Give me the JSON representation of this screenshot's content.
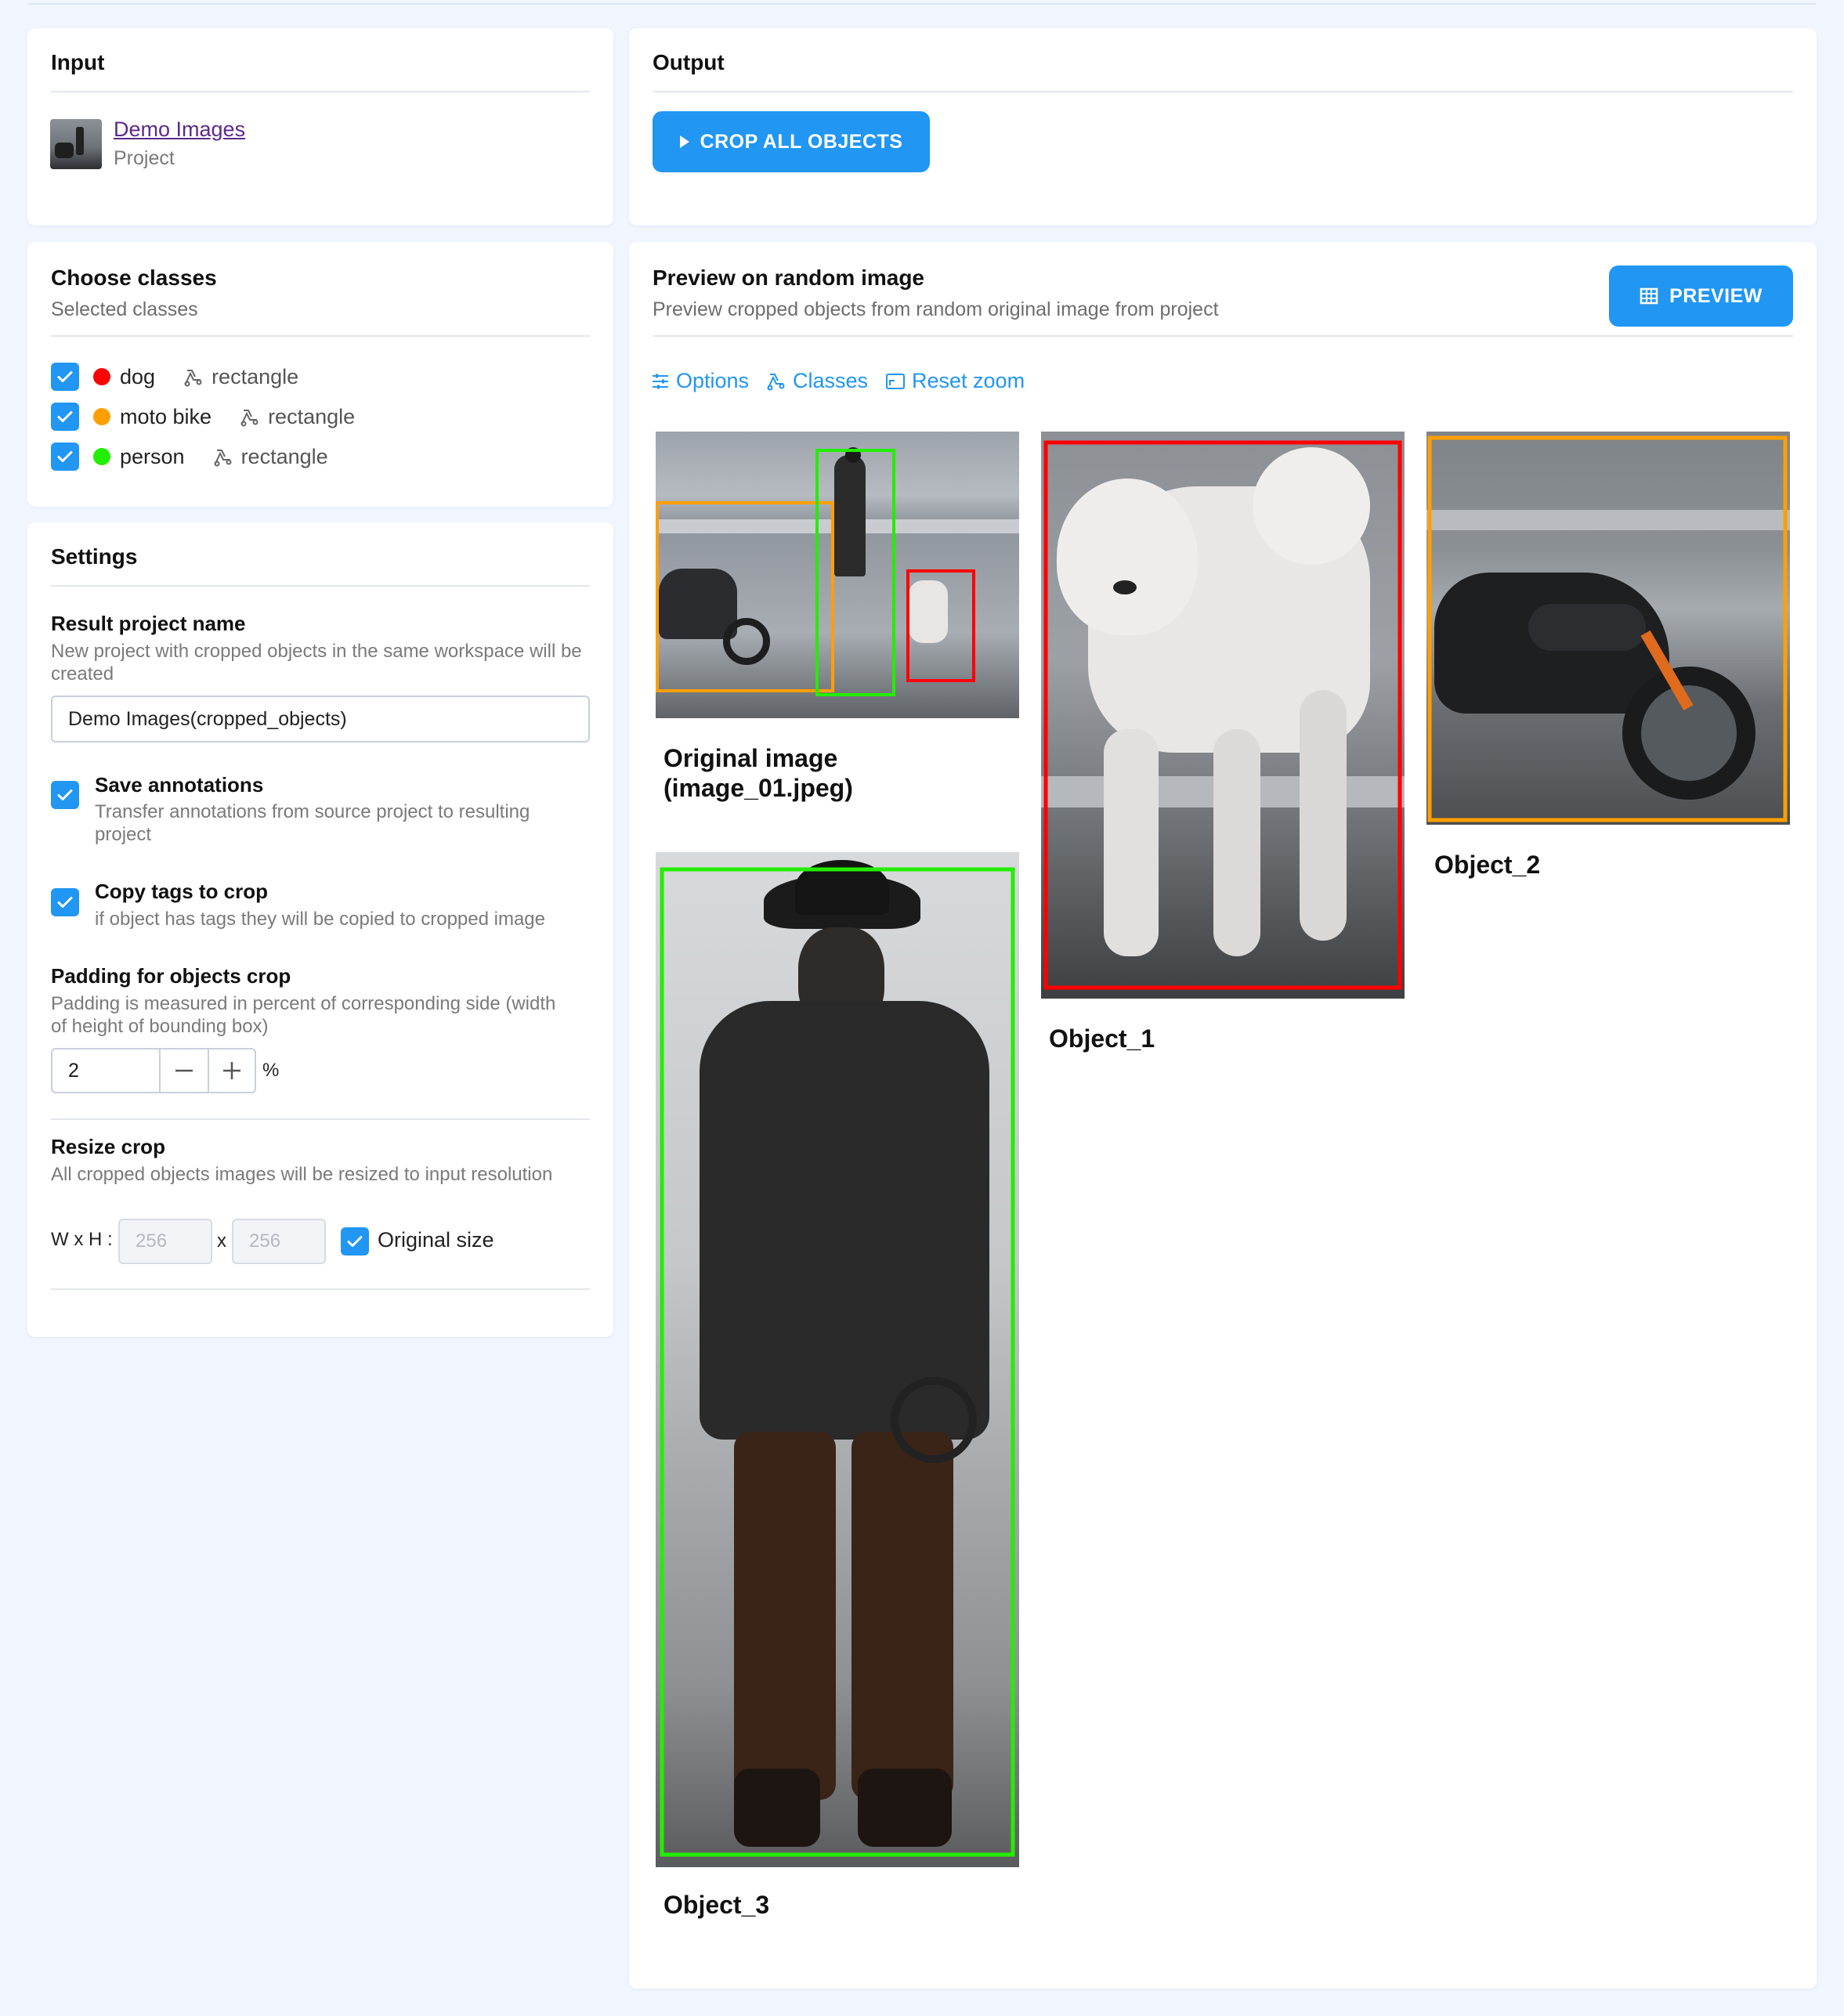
{
  "input": {
    "title": "Input",
    "project_name": "Demo Images",
    "project_type": "Project"
  },
  "output": {
    "title": "Output",
    "crop_button": "CROP ALL OBJECTS"
  },
  "classes": {
    "title": "Choose classes",
    "subtitle": "Selected classes",
    "items": [
      {
        "name": "dog",
        "color": "#ff0000",
        "shape": "rectangle"
      },
      {
        "name": "moto bike",
        "color": "#ff9f00",
        "shape": "rectangle"
      },
      {
        "name": "person",
        "color": "#22ee00",
        "shape": "rectangle"
      }
    ]
  },
  "settings": {
    "title": "Settings",
    "result_name_title": "Result project name",
    "result_name_desc": "New project with cropped objects in the same workspace will be created",
    "result_name_value": "Demo Images(cropped_objects)",
    "save_annotations_title": "Save annotations",
    "save_annotations_desc": "Transfer annotations from source project to resulting project",
    "copy_tags_title": "Copy tags to crop",
    "copy_tags_desc": "if object has tags they will be copied to cropped image",
    "padding_title": "Padding for objects crop",
    "padding_desc": "Padding is measured in percent of corresponding side (width of height of bounding box)",
    "padding_value": "2",
    "padding_unit": "%",
    "resize_title": "Resize crop",
    "resize_desc": "All cropped objects images will be resized to input resolution",
    "wh_label": "W x H :",
    "width_placeholder": "256",
    "x_label": "x",
    "height_placeholder": "256",
    "original_size_label": "Original size"
  },
  "preview": {
    "title": "Preview on random image",
    "subtitle": "Preview cropped objects from random original image from project",
    "preview_button": "PREVIEW",
    "options_label": "Options",
    "classes_label": "Classes",
    "reset_zoom_label": "Reset zoom",
    "original_caption_line1": "Original image",
    "original_caption_line2": "(image_01.jpeg)",
    "object1_caption": "Object_1",
    "object2_caption": "Object_2",
    "object3_caption": "Object_3"
  },
  "colors": {
    "accent": "#2196f3",
    "dog": "#ff0000",
    "moto_bike": "#ff9f00",
    "person": "#22ee00"
  }
}
